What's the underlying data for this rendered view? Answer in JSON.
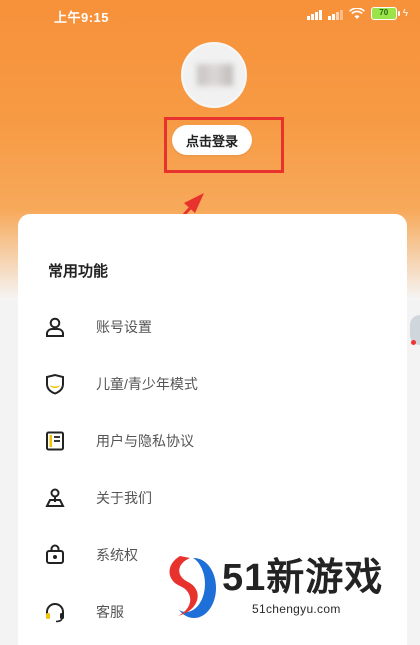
{
  "status_bar": {
    "time": "上午9:15",
    "battery": "70"
  },
  "profile": {
    "login_button": "点击登录"
  },
  "section": {
    "title": "常用功能",
    "items": [
      {
        "label": "账号设置",
        "icon": "person-icon"
      },
      {
        "label": "儿童/青少年模式",
        "icon": "shield-icon"
      },
      {
        "label": "用户与隐私协议",
        "icon": "document-icon"
      },
      {
        "label": "关于我们",
        "icon": "location-pin-icon"
      },
      {
        "label": "系统权",
        "icon": "lock-bag-icon"
      },
      {
        "label": "客服",
        "icon": "headset-icon"
      }
    ]
  },
  "watermark": {
    "title": "51新游戏",
    "url": "51chengyu.com"
  },
  "colors": {
    "accent": "#f7913a",
    "highlight": "#e8322d"
  }
}
